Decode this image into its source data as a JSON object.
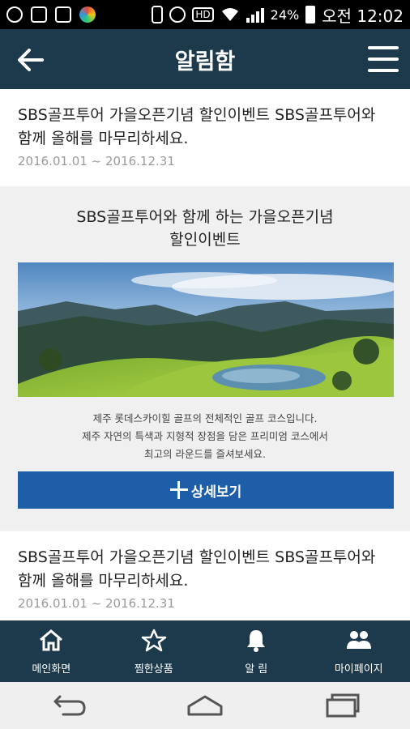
{
  "status_bar": {
    "battery": "24%",
    "time": "오전 12:02",
    "hd": "HD"
  },
  "app_bar": {
    "title": "알림함"
  },
  "notices": [
    {
      "title": "SBS골프투어 가을오픈기념 할인이벤트 SBS골프투어와 함께 올해를 마무리하세요.",
      "date": "2016.01.01 ~ 2016.12.31"
    },
    {
      "title": "SBS골프투어 가을오픈기념 할인이벤트 SBS골프투어와 함께 올해를 마무리하세요.",
      "date": "2016.01.01 ~ 2016.12.31"
    }
  ],
  "event": {
    "title_line1": "SBS골프투어와 함께 하는 가을오픈기념",
    "title_line2": "할인이벤트",
    "desc_line1": "제주 롯데스카이힐 골프의 전체적인 골프 코스입니다.",
    "desc_line2": "제주 자연의 특색과 지형적 장점을 담은 프리미엄 코스에서",
    "desc_line3": "최고의 라운드를 즐셔보세요.",
    "button_label": "상세보기"
  },
  "bottom_nav": [
    {
      "label": "메인화면",
      "icon": "home-icon"
    },
    {
      "label": "찜한상품",
      "icon": "star-icon"
    },
    {
      "label": "알 림",
      "icon": "bell-icon"
    },
    {
      "label": "마이페이지",
      "icon": "people-icon"
    }
  ],
  "colors": {
    "header": "#1d3a4d",
    "button": "#1e5ea8"
  }
}
